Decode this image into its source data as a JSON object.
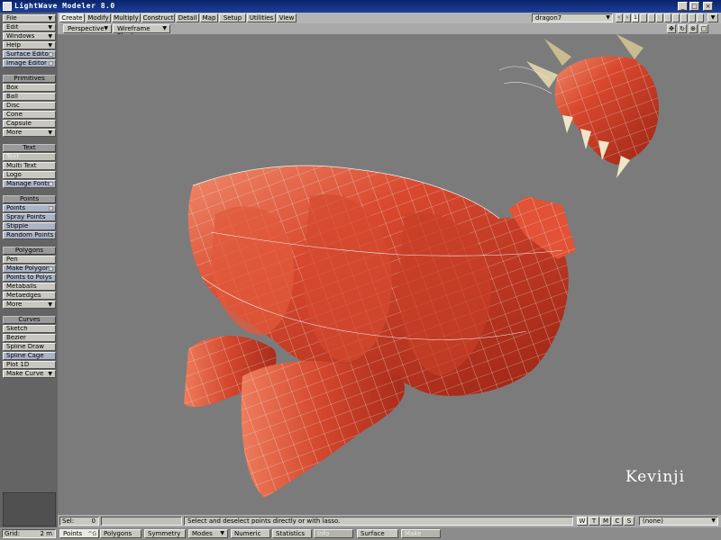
{
  "window": {
    "title": "LightWave Modeler 8.0",
    "controls": [
      "_",
      "□",
      "×"
    ]
  },
  "sidebar": {
    "menu": [
      {
        "label": "File"
      },
      {
        "label": "Edit"
      },
      {
        "label": "Windows"
      },
      {
        "label": "Help"
      },
      {
        "label": "Surface Editor"
      },
      {
        "label": "Image Editor"
      }
    ],
    "groups": {
      "primitives": {
        "header": "Primitives",
        "items": [
          "Box",
          "Ball",
          "Disc",
          "Cone",
          "Capsule",
          "More"
        ]
      },
      "text": {
        "header": "Text",
        "items": [
          "Text",
          "Multi Text",
          "Logo",
          "Manage Fonts"
        ]
      },
      "points": {
        "header": "Points",
        "items": [
          "Points",
          "Spray Points",
          "Stipple",
          "Random Points"
        ]
      },
      "polygons": {
        "header": "Polygons",
        "items": [
          "Pen",
          "Make Polygon",
          "Points to Polys",
          "Metaballs",
          "Metaedges",
          "More"
        ]
      },
      "curves": {
        "header": "Curves",
        "items": [
          "Sketch",
          "Bezier",
          "Spline Draw",
          "Spline Cage",
          "Plot 1D",
          "Make Curve"
        ]
      }
    }
  },
  "tabs": [
    "Create",
    "Modify",
    "Multiply",
    "Construct",
    "Detail",
    "Map",
    "Setup",
    "Utilities",
    "View"
  ],
  "object_selector": {
    "value": "dragon7"
  },
  "layers": [
    "1"
  ],
  "viewport": {
    "projection": "Perspective",
    "render_mode": "Wireframe Shade",
    "watermark": "Kevinji"
  },
  "status": {
    "sel_label": "Sel:",
    "sel_value": "0",
    "message": "Select and deselect points directly or with lasso.",
    "wtmcs": [
      "W",
      "T",
      "M",
      "C",
      "S"
    ],
    "surface": "(none)"
  },
  "modebar": {
    "grid_label": "Grid:",
    "grid_value": "2 m",
    "points": "Points",
    "points_key": "^G",
    "polygons": "Polygons",
    "symmetry": "Symmetry",
    "modes": "Modes",
    "numeric": "Numeric",
    "statistics": "Statistics",
    "info": "Info",
    "surface": "Surface",
    "make": "Make"
  },
  "colors": {
    "viewport_bg": "#7b7b7b",
    "mesh": "#c83a26",
    "wire": "#e6e6e6"
  }
}
